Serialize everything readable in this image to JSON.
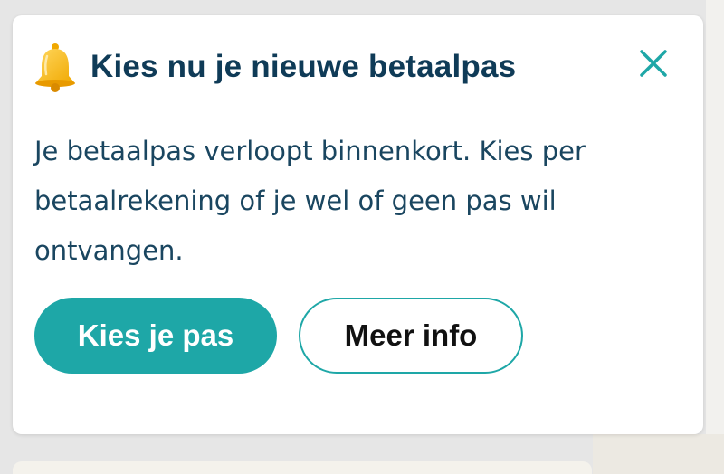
{
  "notification": {
    "icon": "bell-icon",
    "title": "Kies nu je nieuwe betaalpas",
    "close_icon": "close-icon",
    "body": "Je betaalpas verloopt binnenkort. Kies per betaalrekening of je wel of geen pas wil ontvangen.",
    "primary_button_label": "Kies je pas",
    "secondary_button_label": "Meer info"
  },
  "colors": {
    "accent": "#1ea7a7",
    "title": "#0f3b57",
    "body_text": "#1a4660",
    "bell": "#f4b400"
  }
}
